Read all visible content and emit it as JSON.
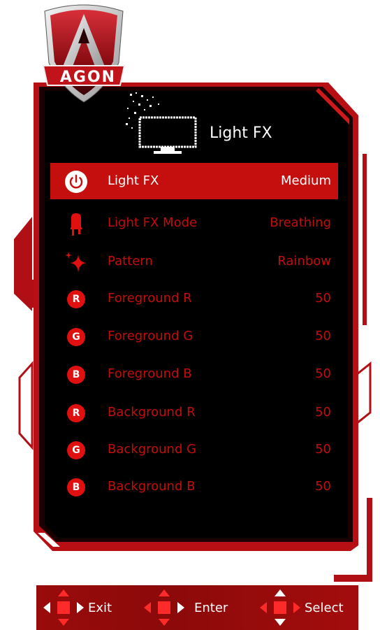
{
  "brand": {
    "logo_text": "AGON"
  },
  "header": {
    "title": "Light FX",
    "icon": "monitor-light-icon"
  },
  "menu": {
    "items": [
      {
        "icon": "power-icon",
        "label": "Light FX",
        "value": "Medium",
        "selected": true
      },
      {
        "icon": "bulb-icon",
        "label": "Light FX Mode",
        "value": "Breathing",
        "selected": false
      },
      {
        "icon": "sparkle-icon",
        "label": "Pattern",
        "value": "Rainbow",
        "selected": false
      },
      {
        "icon": "badge-r-icon",
        "badge": "R",
        "label": "Foreground R",
        "value": "50",
        "selected": false
      },
      {
        "icon": "badge-g-icon",
        "badge": "G",
        "label": "Foreground G",
        "value": "50",
        "selected": false
      },
      {
        "icon": "badge-b-icon",
        "badge": "B",
        "label": "Foreground B",
        "value": "50",
        "selected": false
      },
      {
        "icon": "badge-r-icon",
        "badge": "R",
        "label": "Background R",
        "value": "50",
        "selected": false
      },
      {
        "icon": "badge-g-icon",
        "badge": "G",
        "label": "Background G",
        "value": "50",
        "selected": false
      },
      {
        "icon": "badge-b-icon",
        "badge": "B",
        "label": "Background B",
        "value": "50",
        "selected": false
      }
    ]
  },
  "footer": {
    "exit_label": "Exit",
    "enter_label": "Enter",
    "select_label": "Select"
  },
  "colors": {
    "accent": "#c50f0f",
    "text_inactive": "#c20d0d",
    "panel": "#000000"
  }
}
